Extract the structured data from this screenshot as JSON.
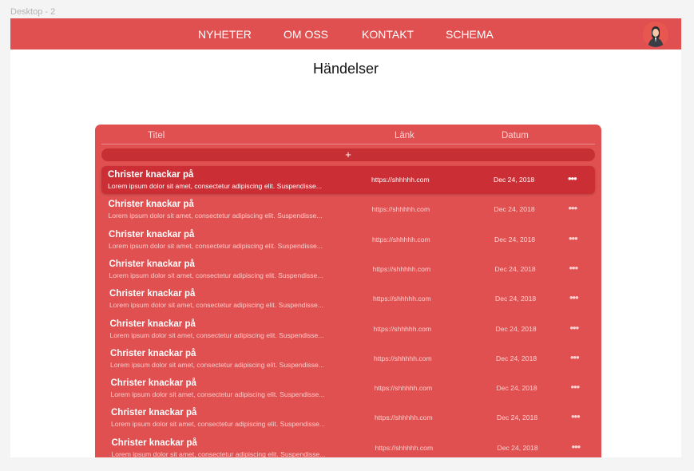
{
  "canvas": {
    "label": "Desktop - 2"
  },
  "nav": {
    "items": [
      {
        "label": "NYHETER"
      },
      {
        "label": "OM OSS"
      },
      {
        "label": "KONTAKT"
      },
      {
        "label": "SCHEMA"
      }
    ]
  },
  "page": {
    "title": "Händelser"
  },
  "table": {
    "columns": {
      "title": "Titel",
      "link": "Länk",
      "date": "Datum"
    },
    "add_label": "+",
    "more_label": "•••",
    "rows": [
      {
        "title": "Christer knackar på",
        "description": "Lorem ipsum dolor sit amet, consectetur adipiscing elit. Suspendisse...",
        "link": "https://shhhhh.com",
        "date": "Dec 24, 2018",
        "selected": true
      },
      {
        "title": "Christer knackar på",
        "description": "Lorem ipsum dolor sit amet, consectetur adipiscing elit. Suspendisse...",
        "link": "https://shhhhh.com",
        "date": "Dec 24, 2018"
      },
      {
        "title": "Christer knackar på",
        "description": "Lorem ipsum dolor sit amet, consectetur adipiscing elit. Suspendisse...",
        "link": "https://shhhhh.com",
        "date": "Dec 24, 2018"
      },
      {
        "title": "Christer knackar på",
        "description": "Lorem ipsum dolor sit amet, consectetur adipiscing elit. Suspendisse...",
        "link": "https://shhhhh.com",
        "date": "Dec 24, 2018"
      },
      {
        "title": "Christer knackar på",
        "description": "Lorem ipsum dolor sit amet, consectetur adipiscing elit. Suspendisse...",
        "link": "https://shhhhh.com",
        "date": "Dec 24, 2018"
      },
      {
        "title": "Christer knackar på",
        "description": "Lorem ipsum dolor sit amet, consectetur adipiscing elit. Suspendisse...",
        "link": "https://shhhhh.com",
        "date": "Dec 24, 2018"
      },
      {
        "title": "Christer knackar på",
        "description": "Lorem ipsum dolor sit amet, consectetur adipiscing elit. Suspendisse...",
        "link": "https://shhhhh.com",
        "date": "Dec 24, 2018"
      },
      {
        "title": "Christer knackar på",
        "description": "Lorem ipsum dolor sit amet, consectetur adipiscing elit. Suspendisse...",
        "link": "https://shhhhh.com",
        "date": "Dec 24, 2018"
      },
      {
        "title": "Christer knackar på",
        "description": "Lorem ipsum dolor sit amet, consectetur adipiscing elit. Suspendisse...",
        "link": "https://shhhhh.com",
        "date": "Dec 24, 2018"
      },
      {
        "title": "Christer knackar på",
        "description": "Lorem ipsum dolor sit amet, consectetur adipiscing elit. Suspendisse...",
        "link": "https://shhhhh.com",
        "date": "Dec 24, 2018"
      }
    ]
  },
  "colors": {
    "accent": "#e05050",
    "selected_row": "#cc2e35",
    "add_bar": "#c62f33"
  }
}
